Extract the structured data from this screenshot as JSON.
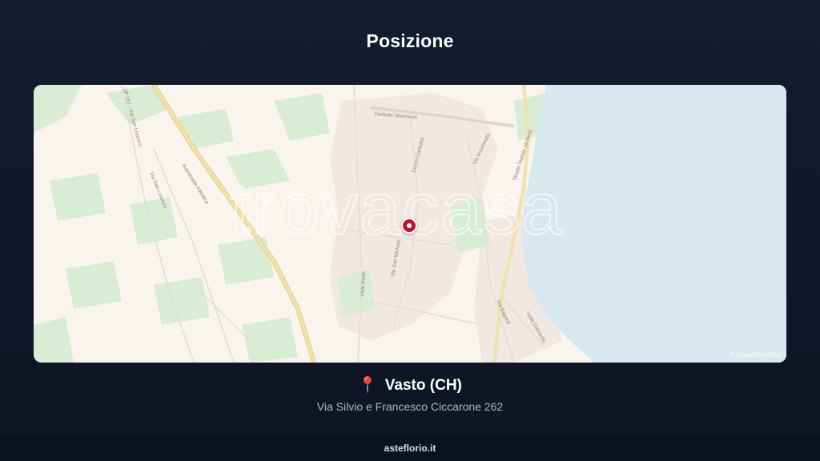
{
  "section": {
    "title": "Posizione"
  },
  "map": {
    "watermark": "trovacasa",
    "attribution": "© OpenStreetMap",
    "street_labels": {
      "ss16": "Strada Statale 16 Nord",
      "viadotto": "Viadotto Histonium",
      "autostrada": "Autostrada Adriatica",
      "sp157": "SP 157 - Via San Lorenzo",
      "via_san_lorenzo": "Via San Lorenzo",
      "corso": "Corso Garibaldi",
      "via_perth": "Viale Perth",
      "via_san_michele": "Via San Michele",
      "via_bagnoli": "Via Bagnoli",
      "via_incoronata": "Via Incoronata",
      "viale_dalmazia": "Viale Dalmazia"
    },
    "colors": {
      "land": "#faf4ef",
      "sea": "#d7e9ee",
      "green": "#d6ecd2",
      "highway": "#ead79a",
      "marker": "#c0152b"
    }
  },
  "location": {
    "icon": "📍",
    "name": "Vasto (CH)",
    "address": "Via Silvio e Francesco Ciccarone 262"
  },
  "footer": {
    "link": "asteflorio.it"
  }
}
